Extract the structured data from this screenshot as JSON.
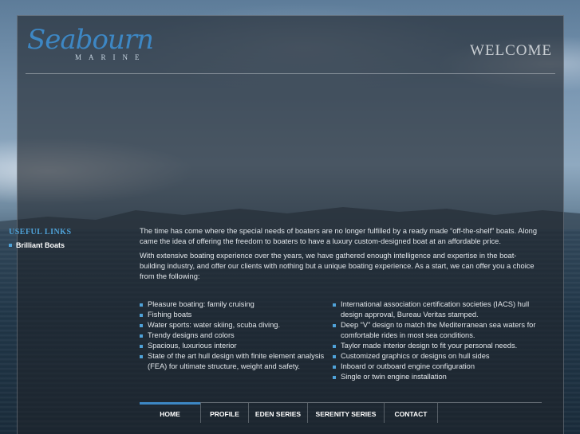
{
  "header": {
    "logo_script": "Seabourn",
    "logo_sub": "MARINE",
    "page_title": "WELCOME"
  },
  "sidebar": {
    "title": "USEFUL LINKS",
    "items": [
      {
        "label": "Brilliant Boats"
      }
    ]
  },
  "intro": {
    "paragraph1": "The time has come where the special needs of boaters are no longer fulfilled by a ready made “off-the-shelf” boats. Along came the idea of offering the freedom to boaters to have a luxury custom-designed boat at an affordable price.",
    "paragraph2": "With extensive boating experience over the years, we have gathered enough intelligence and expertise in the boat-building industry, and offer our clients with nothing but a unique boating experience. As a start, we can offer you a choice from the following:"
  },
  "features_left": [
    "Pleasure boating: family cruising",
    "Fishing boats",
    "Water sports: water skiing, scuba diving.",
    "Trendy designs and colors",
    "Spacious, luxurious interior",
    "State of the art hull design with finite element analysis (FEA) for ultimate structure, weight and safety."
  ],
  "features_right": [
    "International association certification societies (IACS) hull design approval, Bureau Veritas stamped.",
    "Deep “V” design to match the Mediterranean sea waters for  comfortable rides in most sea conditions.",
    "Taylor made interior design to fit your personal needs.",
    "Customized graphics or designs on hull sides",
    "Inboard or outboard engine configuration",
    "Single or twin engine installation"
  ],
  "nav": {
    "items": [
      {
        "label": "HOME",
        "active": true
      },
      {
        "label": "PROFILE"
      },
      {
        "label": "EDEN SERIES"
      },
      {
        "label": "SERENITY SERIES"
      },
      {
        "label": "CONTACT"
      }
    ]
  },
  "colors": {
    "accent": "#3d87c4",
    "link_title": "#4fa2d8",
    "panel": "#1e242a"
  }
}
